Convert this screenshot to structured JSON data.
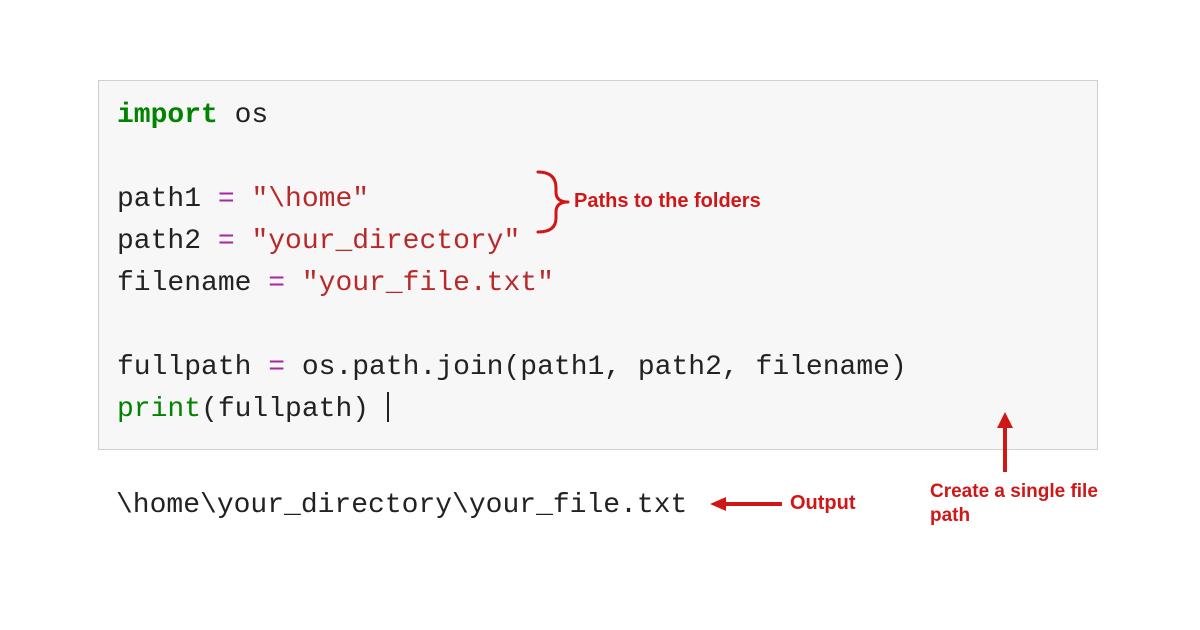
{
  "code": {
    "line1": {
      "kw": "import",
      "mod": " os"
    },
    "line3_var": "path1 ",
    "line3_eq": "= ",
    "line3_str": "\"\\home\"",
    "line4_var": "path2 ",
    "line4_eq": "= ",
    "line4_str": "\"your_directory\"",
    "line5_var": "filename ",
    "line5_eq": "= ",
    "line5_str": "\"your_file.txt\"",
    "line7_var": "fullpath ",
    "line7_eq": "= ",
    "line7_call": "os.path.join(path1, path2, filename)",
    "line8_fn": "print",
    "line8_args": "(fullpath)"
  },
  "output": "\\home\\your_directory\\your_file.txt",
  "annotations": {
    "paths": "Paths to the folders",
    "create": "Create a single file\npath",
    "output": "Output"
  }
}
